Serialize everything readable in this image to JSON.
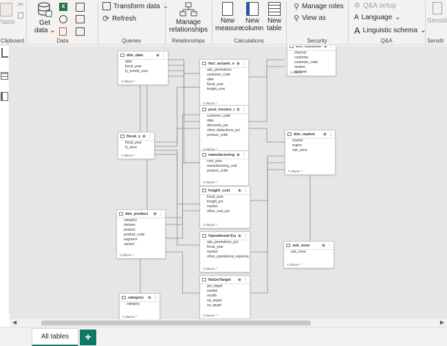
{
  "ribbon": {
    "clipboard": {
      "paste": "Paste",
      "label": "Clipboard"
    },
    "data": {
      "get_data": "Get",
      "get_data2": "data",
      "label": "Data"
    },
    "queries": {
      "transform": "Transform data",
      "refresh": "Refresh",
      "label": "Queries"
    },
    "relationships": {
      "manage": "Manage",
      "manage2": "relationships",
      "label": "Relationships"
    },
    "calculations": {
      "new_measure": "New",
      "new_measure2": "measure",
      "new_column": "New",
      "new_column2": "column",
      "new_table": "New",
      "new_table2": "table",
      "label": "Calculations"
    },
    "security": {
      "manage_roles": "Manage roles",
      "view_as": "View as",
      "label": "Security"
    },
    "qa": {
      "setup": "Q&A setup",
      "language": "Language",
      "ling_schema": "Linguistic schema",
      "label": "Q&A"
    },
    "sensitivity": {
      "text": "Sensiti",
      "label": "Sensiti"
    }
  },
  "tables": [
    {
      "name": "dim_date",
      "fields": [
        "date",
        "fiscal_year",
        "fy_month_num"
      ]
    },
    {
      "name": "fact_actuals_estimates",
      "fields": [
        "ads_promotions",
        "customer_code",
        "date",
        "fiscal_year",
        "freight_cost"
      ]
    },
    {
      "name": "post_invoice_deductio...",
      "fields": [
        "customer_code",
        "date",
        "discounts_pct",
        "other_deductions_pct",
        "product_code"
      ]
    },
    {
      "name": "fiscal_year",
      "fields": [
        "fiscal_year",
        "fy_desc"
      ]
    },
    {
      "name": "manufacturing_cost",
      "fields": [
        "cost_year",
        "manufacturing_cost",
        "product_code"
      ]
    },
    {
      "name": "freight_cost",
      "fields": [
        "fiscal_year",
        "freight_pct",
        "market",
        "other_cost_pct"
      ]
    },
    {
      "name": "dim_product",
      "fields": [
        "category",
        "division",
        "product",
        "product_code",
        "segment",
        "variant"
      ]
    },
    {
      "name": "Operational Expense",
      "fields": [
        "ads_promotions_pct",
        "fiscal_year",
        "market",
        "other_operational_expense_pct"
      ]
    },
    {
      "name": "NsGmTarget",
      "fields": [
        "gm_target",
        "market",
        "month",
        "np_target",
        "ns_target"
      ]
    },
    {
      "name": "category",
      "fields": [
        "category"
      ]
    },
    {
      "name": "dim_market",
      "fields": [
        "market",
        "region",
        "sub_zone"
      ]
    },
    {
      "name": "sub_zone",
      "fields": [
        "sub_zone"
      ]
    },
    {
      "name": "dim_customer",
      "fields": [
        "channel",
        "customer",
        "customer_code",
        "market",
        "platform"
      ]
    }
  ],
  "card_ui": {
    "collapse": "Collapse ^"
  },
  "tabs": {
    "all_tables": "All tables",
    "add": "+"
  },
  "colors": {
    "accent": "#117865",
    "canvas": "#e6e6e6",
    "ribbon": "#f3f2f1"
  }
}
